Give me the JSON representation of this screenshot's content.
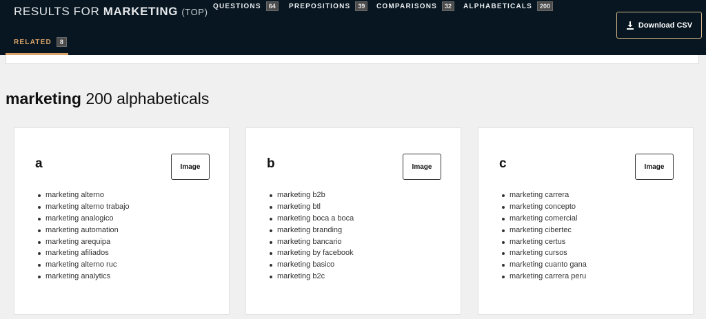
{
  "header": {
    "results_prefix": "RESULTS FOR",
    "keyword": "MARKETING",
    "scope": "(TOP)",
    "download_label": "Download CSV",
    "download_icon": "download-icon"
  },
  "tabs": [
    {
      "label": "QUESTIONS",
      "count": "64"
    },
    {
      "label": "PREPOSITIONS",
      "count": "39"
    },
    {
      "label": "COMPARISONS",
      "count": "32"
    },
    {
      "label": "ALPHABETICALS",
      "count": "200"
    },
    {
      "label": "RELATED",
      "count": "8",
      "active": true
    }
  ],
  "section": {
    "keyword": "marketing",
    "rest": " 200 alphabeticals"
  },
  "cards": [
    {
      "letter": "a",
      "button": "Image",
      "items": [
        "marketing alterno",
        "marketing alterno trabajo",
        "marketing analogico",
        "marketing automation",
        "marketing arequipa",
        "marketing afiliados",
        "marketing alterno ruc",
        "marketing analytics"
      ]
    },
    {
      "letter": "b",
      "button": "Image",
      "items": [
        "marketing b2b",
        "marketing btl",
        "marketing boca a boca",
        "marketing branding",
        "marketing bancario",
        "marketing by facebook",
        "marketing basico",
        "marketing b2c"
      ]
    },
    {
      "letter": "c",
      "button": "Image",
      "items": [
        "marketing carrera",
        "marketing concepto",
        "marketing comercial",
        "marketing cibertec",
        "marketing certus",
        "marketing cursos",
        "marketing cuanto gana",
        "marketing carrera peru"
      ]
    }
  ],
  "colors": {
    "header_bg": "#071620",
    "accent": "#d8a36a",
    "page_bg": "#f0f0f0"
  }
}
